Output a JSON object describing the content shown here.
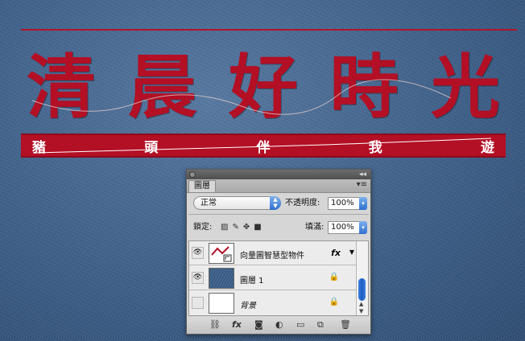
{
  "canvas": {
    "title_chars": [
      "清",
      "晨",
      "好",
      "時",
      "光"
    ],
    "banner_chars": [
      "豬",
      "頭",
      "伴",
      "我",
      "遊"
    ],
    "colors": {
      "title_red": "#b30f25",
      "denim": "#3d5f86",
      "stitch": "#ffffff"
    }
  },
  "panel": {
    "tab_label": "圖層",
    "blend_mode": "正常",
    "opacity_label": "不透明度:",
    "opacity_value": "100%",
    "lock_label": "鎖定:",
    "fill_label": "填滿:",
    "fill_value": "100%",
    "layers": [
      {
        "name": "向量圖智慧型物件",
        "visible": true,
        "fx": "fx",
        "thumb": "smart-object-icon"
      },
      {
        "name": "圖層 1",
        "visible": true,
        "thumb": "denim-icon"
      },
      {
        "name": "背景",
        "visible": false,
        "thumb": "white-icon"
      }
    ],
    "footer_icons": [
      "link-icon",
      "fx-icon",
      "mask-icon",
      "adjustment-icon",
      "folder-icon",
      "new-layer-icon",
      "trash-icon"
    ]
  }
}
